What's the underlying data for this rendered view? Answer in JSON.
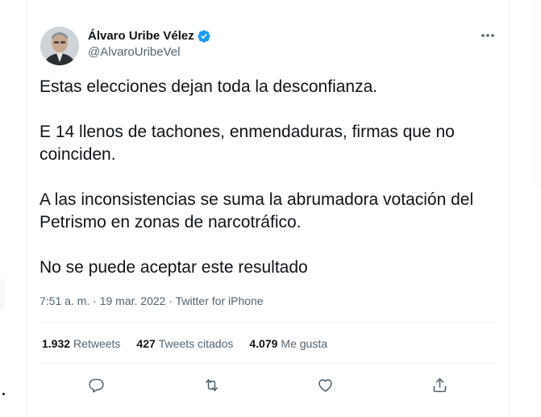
{
  "author": {
    "name": "Álvaro Uribe Vélez",
    "handle": "@AlvaroUribeVel",
    "verified": true
  },
  "tweet": {
    "paragraphs": [
      "Estas elecciones dejan toda la desconfianza.",
      "E 14 llenos de tachones, enmendaduras, firmas que no coinciden.",
      "A las inconsistencias se suma la abrumadora votación del Petrismo en zonas de narcotráfico.",
      "No se puede aceptar este resultado"
    ]
  },
  "meta": {
    "time": "7:51 a. m.",
    "separator": " · ",
    "date": "19 mar. 2022",
    "source": "Twitter for iPhone"
  },
  "stats": {
    "retweets": {
      "count": "1.932",
      "label": "Retweets"
    },
    "quotes": {
      "count": "427",
      "label": "Tweets citados"
    },
    "likes": {
      "count": "4.079",
      "label": "Me gusta"
    }
  },
  "actions": [
    "reply-icon",
    "retweet-icon",
    "like-icon",
    "share-icon"
  ],
  "colors": {
    "text": "#0f1419",
    "secondary": "#536471",
    "verified": "#1d9bf0",
    "divider": "#eff3f4"
  }
}
